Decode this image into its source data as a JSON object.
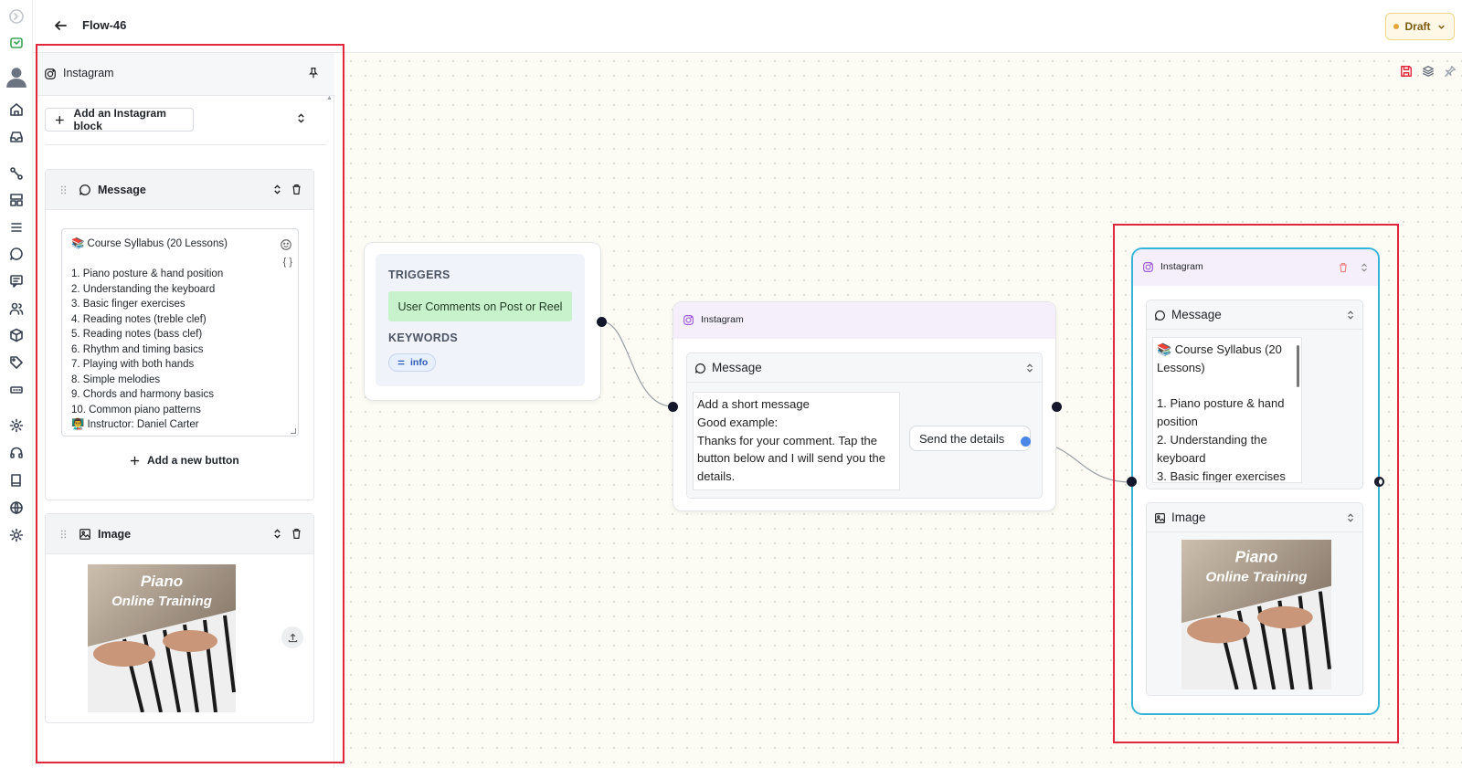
{
  "topbar": {
    "flow_title": "Flow-46",
    "status": "Draft"
  },
  "panel": {
    "title": "Instagram",
    "add_block_label": "Add an Instagram block",
    "message_card": {
      "title": "Message",
      "lines": [
        "📚 Course Syllabus (20 Lessons)",
        "",
        "1. Piano posture & hand position",
        "2. Understanding the keyboard",
        "3. Basic finger exercises",
        "4. Reading notes (treble clef)",
        "5. Reading notes (bass clef)",
        "6. Rhythm and timing basics",
        "7. Playing with both hands",
        "8. Simple melodies",
        "9. Chords and harmony basics",
        "10. Common piano patterns",
        "👨‍🏫 Instructor: Daniel Carter"
      ],
      "variables_glyph": "{ }",
      "add_button_label": "Add a new button"
    },
    "image_card": {
      "title": "Image",
      "image_text_line1": "Piano",
      "image_text_line2": "Online Training"
    }
  },
  "trigger_node": {
    "triggers_label": "TRIGGERS",
    "trigger_value": "User Comments on Post or Reel",
    "keywords_label": "KEYWORDS",
    "keyword": "info"
  },
  "middle_node": {
    "title": "Instagram",
    "message_title": "Message",
    "message_lines": [
      "Add a short message",
      "Good example:",
      "Thanks for your comment. Tap the",
      "button below and I will send you the",
      "details."
    ],
    "button_label": "Send the details"
  },
  "right_node": {
    "title": "Instagram",
    "message_title": "Message",
    "message_lines": [
      "📚 Course Syllabus (20",
      "Lessons)",
      "",
      "1. Piano posture & hand",
      "position",
      "2. Understanding the",
      "keyboard",
      "3. Basic finger exercises"
    ],
    "image_title": "Image",
    "image_text_line1": "Piano",
    "image_text_line2": "Online Training"
  },
  "colors": {
    "accent_red": "#e2263b",
    "selection_blue": "#36b4d8",
    "trigger_green": "#c7f2cb",
    "draft_orange": "#e8a43a"
  },
  "icons": [
    "instagram-icon",
    "pin-icon",
    "plus-icon",
    "chevron-up-down-icon",
    "drag-handle-icon",
    "message-icon",
    "trash-icon",
    "emoji-icon",
    "image-icon",
    "upload-icon",
    "arrow-left-icon",
    "chevron-down-icon",
    "save-icon",
    "layers-icon"
  ]
}
